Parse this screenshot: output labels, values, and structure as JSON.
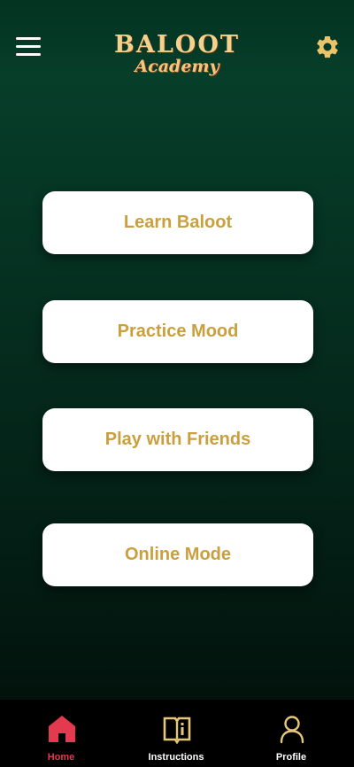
{
  "header": {
    "logo_main": "BALOOT",
    "logo_sub": "Academy"
  },
  "menu": [
    {
      "label": "Learn Baloot"
    },
    {
      "label": "Practice Mood"
    },
    {
      "label": "Play with Friends"
    },
    {
      "label": "Online Mode"
    }
  ],
  "bottom_nav": {
    "items": [
      {
        "label": "Home",
        "icon": "home-icon",
        "active": true
      },
      {
        "label": "Instructions",
        "icon": "book-icon",
        "active": false
      },
      {
        "label": "Profile",
        "icon": "user-icon",
        "active": false
      }
    ]
  },
  "colors": {
    "background_top": "#063e2a",
    "background_bottom": "#010d08",
    "button_text": "#c9a03d",
    "logo_gold": "#f2d28e",
    "nav_active": "#e43a4f",
    "nav_icon": "#e6c77a"
  }
}
